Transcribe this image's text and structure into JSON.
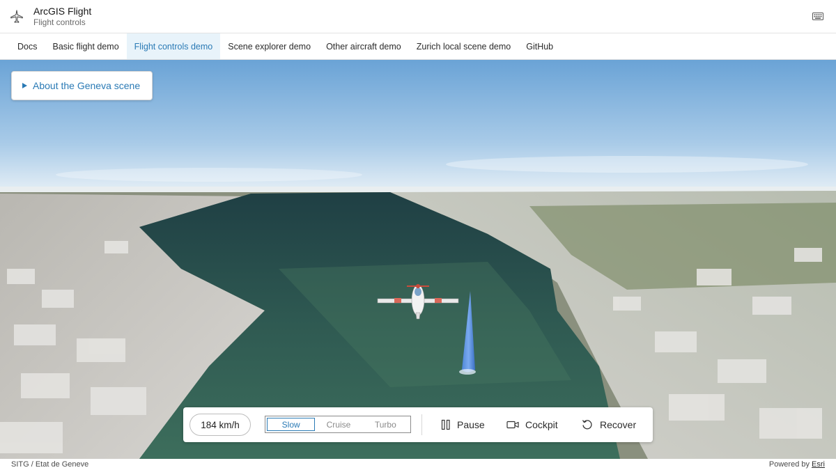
{
  "header": {
    "title": "ArcGIS Flight",
    "subtitle": "Flight controls",
    "logo_icon": "airplane-icon",
    "keyboard_icon": "keyboard-icon"
  },
  "nav": {
    "items": [
      {
        "label": "Docs",
        "active": false
      },
      {
        "label": "Basic flight demo",
        "active": false
      },
      {
        "label": "Flight controls demo",
        "active": true
      },
      {
        "label": "Scene explorer demo",
        "active": false
      },
      {
        "label": "Other aircraft demo",
        "active": false
      },
      {
        "label": "Zurich local scene demo",
        "active": false
      },
      {
        "label": "GitHub",
        "active": false
      }
    ]
  },
  "about": {
    "label": "About the Geneva scene"
  },
  "controls": {
    "speed": "184 km/h",
    "modes": [
      {
        "label": "Slow",
        "active": true
      },
      {
        "label": "Cruise",
        "active": false
      },
      {
        "label": "Turbo",
        "active": false
      }
    ],
    "pause_label": "Pause",
    "cockpit_label": "Cockpit",
    "recover_label": "Recover"
  },
  "attribution": {
    "left": "SITG / Etat de Geneve",
    "powered_prefix": "Powered by",
    "powered_link": "Esri"
  },
  "colors": {
    "accent": "#2a7ab5",
    "sky_top": "#6aa3d6",
    "lake": "#2f5a52"
  }
}
